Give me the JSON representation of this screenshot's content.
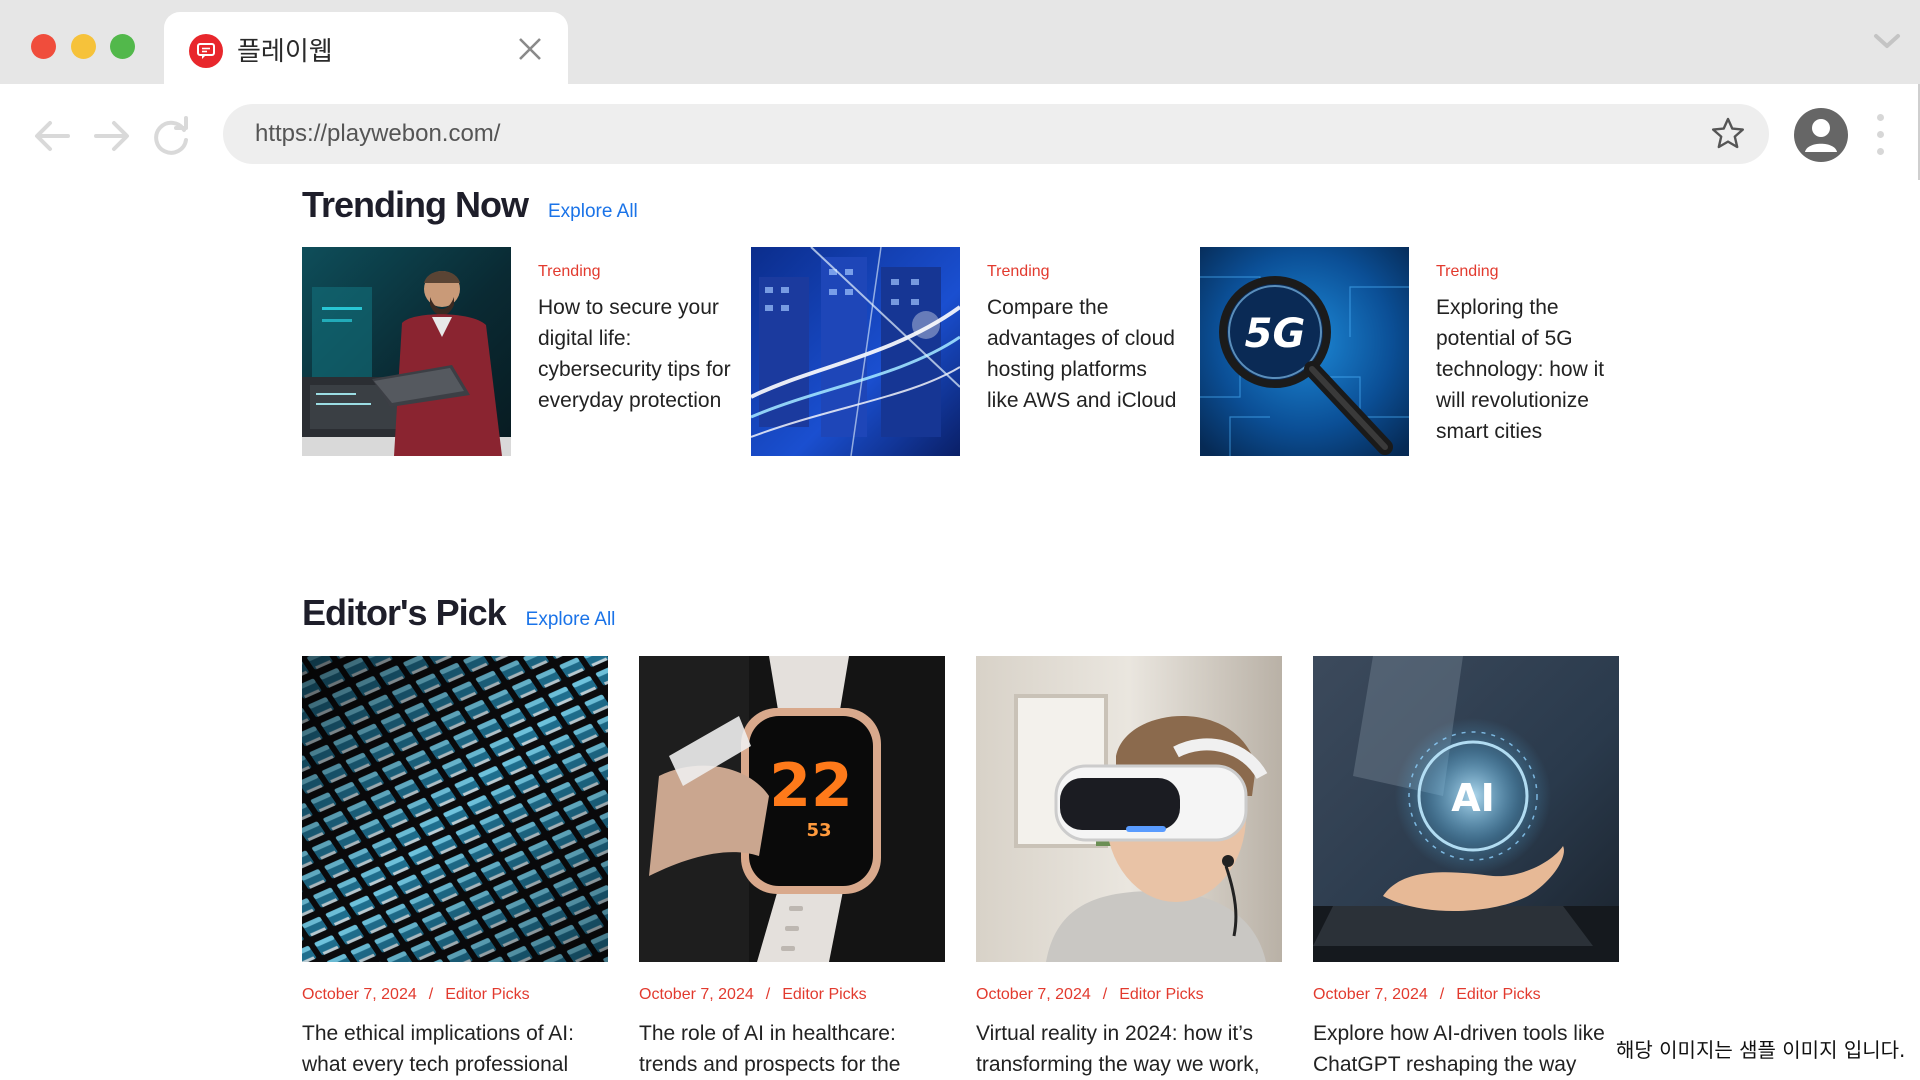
{
  "browser": {
    "tab_title": "플레이웹",
    "url": "https://playwebon.com/",
    "icons": {
      "favicon": "chat-bubble-icon",
      "close": "close-icon",
      "back": "arrow-left-icon",
      "forward": "arrow-right-icon",
      "reload": "reload-icon",
      "bookmark": "star-icon",
      "profile": "user-icon",
      "menu": "kebab-menu-icon",
      "tabs": "chevron-down-icon"
    },
    "colors": {
      "close": "#f04d3c",
      "minimize": "#f6c23a",
      "maximize": "#52b84b",
      "favicon": "#e8272c"
    }
  },
  "trending": {
    "title": "Trending Now",
    "explore": "Explore All",
    "items": [
      {
        "category": "Trending",
        "title": "How to secure your digital life: cybersecurity tips for everyday protection"
      },
      {
        "category": "Trending",
        "title": "Compare the advantages of cloud hosting platforms like AWS and iCloud"
      },
      {
        "category": "Trending",
        "title": "Exploring the potential of 5G technology: how it will revolutionize smart cities"
      }
    ]
  },
  "editors_pick": {
    "title": "Editor's Pick",
    "explore": "Explore All",
    "items": [
      {
        "date": "October 7, 2024",
        "separator": "/",
        "category": "Editor Picks",
        "title": "The ethical implications of AI: what every tech professional"
      },
      {
        "date": "October 7, 2024",
        "separator": "/",
        "category": "Editor Picks",
        "title": "The role of AI in healthcare: trends and prospects for the"
      },
      {
        "date": "October 7, 2024",
        "separator": "/",
        "category": "Editor Picks",
        "title": "Virtual reality in 2024: how it’s transforming the way we work,"
      },
      {
        "date": "October 7, 2024",
        "separator": "/",
        "category": "Editor Picks",
        "title": "Explore how AI-driven tools like ChatGPT reshaping the way"
      }
    ]
  },
  "image_text": {
    "five_g": "5G",
    "watch_big": "22",
    "watch_small": "53",
    "ai": "AI"
  },
  "accent": {
    "category": "#e23a2e",
    "link": "#1a73e8"
  },
  "sample_note": "해당 이미지는 샘플 이미지 입니다."
}
